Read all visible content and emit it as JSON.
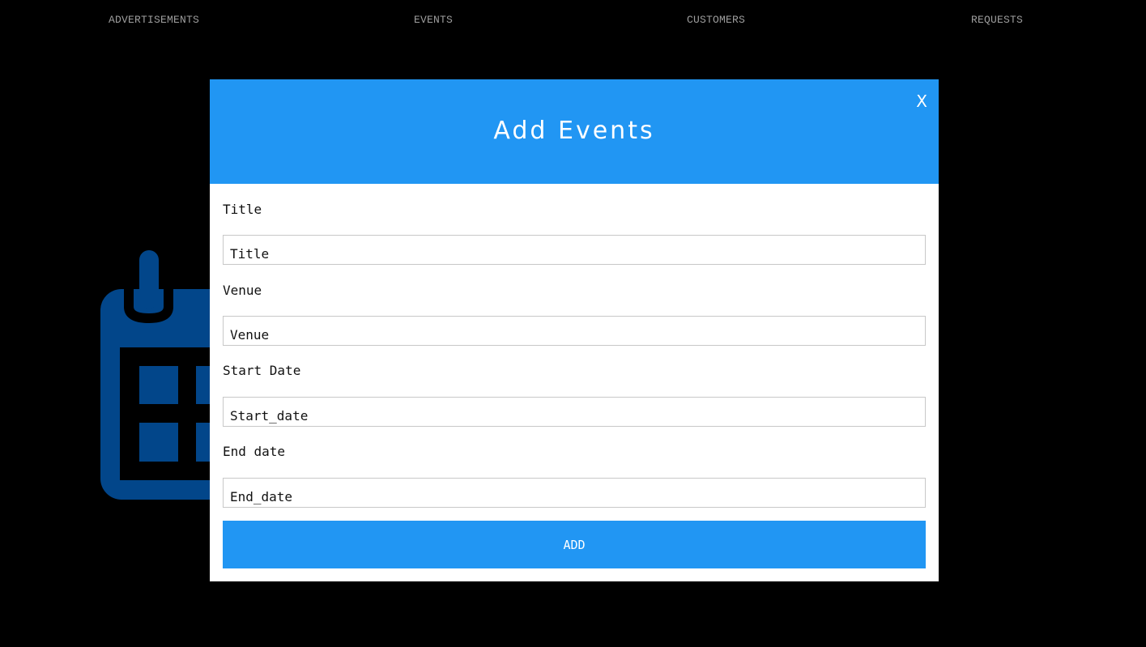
{
  "nav": {
    "items": [
      {
        "label": "ADVERTISEMENTS"
      },
      {
        "label": "EVENTS"
      },
      {
        "label": "CUSTOMERS"
      },
      {
        "label": "REQUESTS"
      }
    ]
  },
  "background": {
    "icon": "calendar-icon",
    "icon_color": "#02468a"
  },
  "modal": {
    "title": "Add Events",
    "close_label": "X",
    "header_color": "#2196f3",
    "fields": [
      {
        "label": "Title",
        "placeholder": "Title"
      },
      {
        "label": "Venue",
        "placeholder": "Venue"
      },
      {
        "label": "Start Date",
        "placeholder": "Start_date"
      },
      {
        "label": "End date",
        "placeholder": "End_date"
      }
    ],
    "submit_label": "ADD"
  }
}
